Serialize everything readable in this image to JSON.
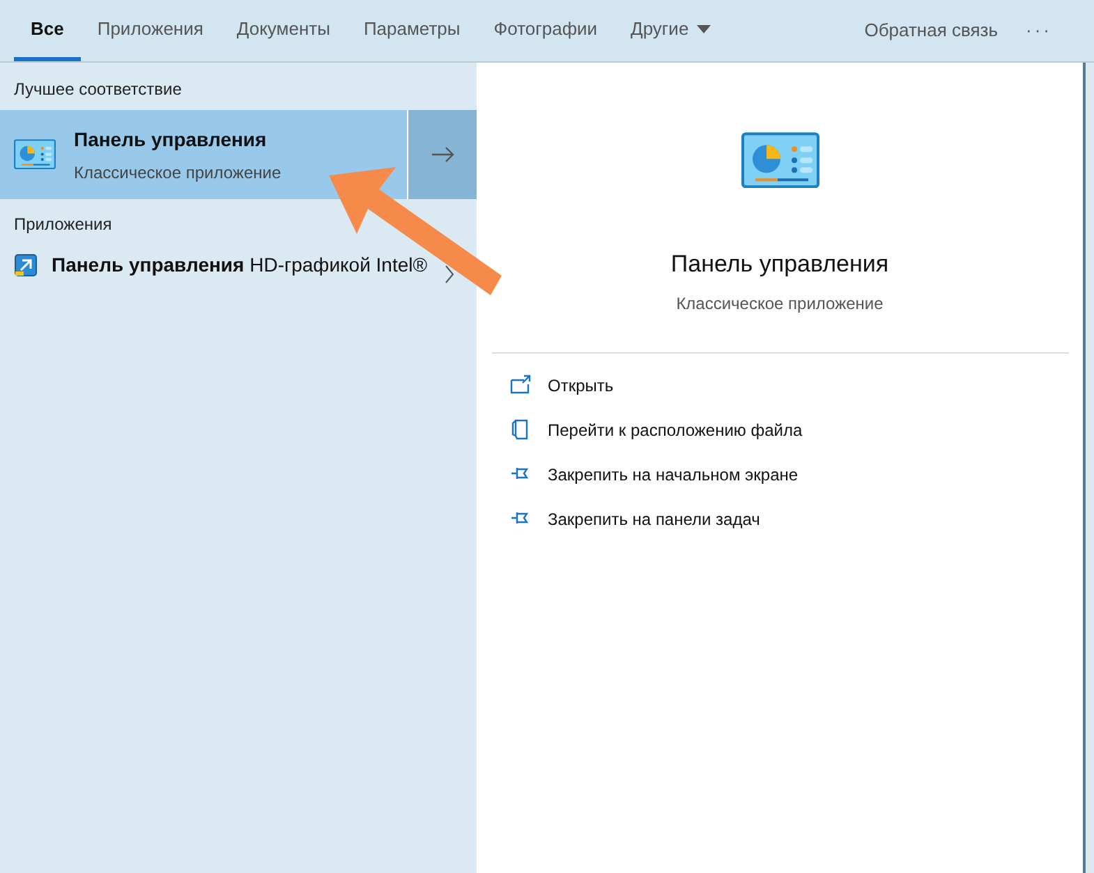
{
  "tabs": [
    {
      "label": "Все",
      "selected": true
    },
    {
      "label": "Приложения",
      "selected": false
    },
    {
      "label": "Документы",
      "selected": false
    },
    {
      "label": "Параметры",
      "selected": false
    },
    {
      "label": "Фотографии",
      "selected": false
    },
    {
      "label": "Другие",
      "selected": false,
      "kind": "dropdown"
    }
  ],
  "feedback": "Обратная связь",
  "more": "···",
  "best_match": {
    "heading": "Лучшее соответствие",
    "title": "Панель управления",
    "subtitle": "Классическое приложение",
    "selected": true
  },
  "apps": {
    "heading": "Приложения",
    "items": [
      {
        "title_bold": "Панель управления",
        "title_rest": "HD-графикой Intel®"
      }
    ]
  },
  "detail": {
    "title": "Панель управления",
    "subtitle": "Классическое приложение",
    "actions": [
      {
        "kind": "open",
        "label": "Открыть"
      },
      {
        "kind": "folder",
        "label": "Перейти к расположению файла"
      },
      {
        "kind": "pin",
        "label": "Закрепить на начальном экране"
      },
      {
        "kind": "pin",
        "label": "Закрепить на панели задач"
      }
    ]
  }
}
